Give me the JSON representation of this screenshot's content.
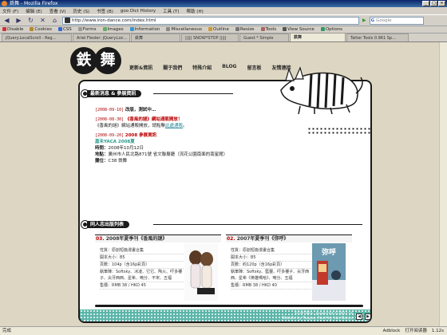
{
  "window": {
    "title": "鉄舞 - Mozilla Firefox"
  },
  "menu": [
    "文件 (F)",
    "编辑 (E)",
    "查看 (V)",
    "历史 (S)",
    "书签 (B)",
    "goo Dict History",
    "工具 (T)",
    "帮助 (H)"
  ],
  "nav": {
    "url": "http://www.iron-dance.com/index.html",
    "search_placeholder": "Google"
  },
  "webdev_toolbar": [
    "Disable",
    "Cookies",
    "CSS",
    "Forms",
    "Images",
    "Information",
    "Miscellaneous",
    "Outline",
    "Resize",
    "Tools",
    "View Source",
    "Options"
  ],
  "tabs": [
    {
      "label": "jQuery.LocalScroll - Reg..."
    },
    {
      "label": "Ariel Flesler: jQuery.Loc..."
    },
    {
      "label": "鉄舞"
    },
    {
      "label": "||||| SNOW*STOP |||||"
    },
    {
      "label": "Guest * Simple"
    },
    {
      "label": "鉄舞",
      "active": true
    },
    {
      "label": "Tatter Tools 0.961 Sp..."
    }
  ],
  "site": {
    "logo_chars": [
      "鉄",
      "舞"
    ],
    "top_nav": [
      "更新&資訊",
      "關于我們",
      "特殊介紹",
      "BLOG",
      "留言板",
      "友情連接"
    ],
    "news_heading": "最新消息 & 參展資訊",
    "news": [
      {
        "date": "[2008-09-10]",
        "text": "改版，測試中…"
      },
      {
        "date": "[2008-08-30]",
        "title": "《香風的謎》網站通販開放！",
        "detail_prefix": "《香風的謎》網站通販開放，請點擊",
        "link": "此處通販",
        "detail_suffix": "。"
      },
      {
        "date": "[2008-09-20]",
        "title": "2008 參展資訊",
        "event": "嘉禾YACA 2008夏",
        "rows": [
          {
            "k": "時間：",
            "v": "2008年10月12日"
          },
          {
            "k": "地點：",
            "v": "廣州市人民北路871號 省文聯展廳（流花公園南面的南星館）"
          },
          {
            "k": "攤位：",
            "v": "C38 鉄舞"
          }
        ]
      }
    ],
    "works_heading": "同人志出版列表",
    "works": [
      {
        "num": "03.",
        "title": "2008年夏季刊《香風的謎》",
        "lines": [
          "性質：原創短篇漫畫合集",
          "開本大小：B5",
          "頁數：104p（含16p彩頁）",
          "執筆陣：Softsky、冰凌、它它、陶火、吓多樓子、尖牙西西、星希、嗚分、不宋、五福",
          "售價：RMB 38 / HKD 45"
        ]
      },
      {
        "num": "02.",
        "title": "2007年夏季刊《弥呼》",
        "lines": [
          "性質：原創短篇漫畫合集",
          "開本大小：B5",
          "頁數：約120p（含16p彩頁）",
          "執筆陣：Softsky、藍靈、吓多樓子、尖牙西西、星希《英雄嗎哈》、嗚分、五福",
          "售價：RMB 38 / HKD 40"
        ]
      }
    ],
    "footer": [
      "©D#T80+ .Javascript ©2003 v4",
      "Website by Tuayeo, Paint by iron-Dance"
    ],
    "footer_buttons": [
      "◀",
      "▶"
    ]
  },
  "status": {
    "left": "完成",
    "right": [
      "Adblock",
      "打开阅读器",
      "1.12s"
    ]
  },
  "colors": {
    "accent_teal": "#5ab5a8",
    "title_red": "#b00000",
    "link_teal": "#2a8a9a"
  }
}
